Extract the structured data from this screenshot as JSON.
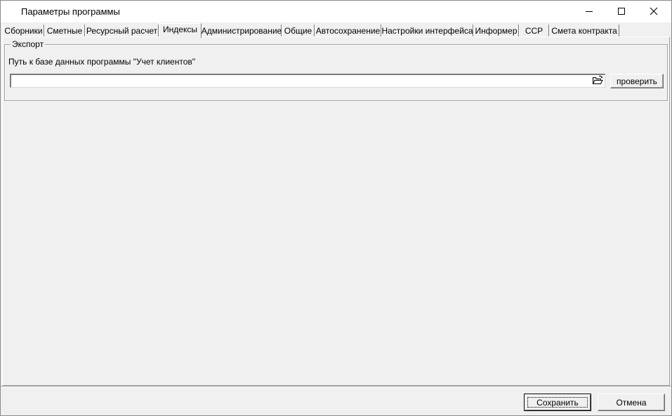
{
  "window": {
    "title": "Параметры программы",
    "icons": {
      "app": "app-icon",
      "minimize": "minimize-icon",
      "maximize": "maximize-icon",
      "close": "close-icon"
    }
  },
  "tabs": [
    {
      "label": "Сборники",
      "active": false
    },
    {
      "label": "Сметные",
      "active": false
    },
    {
      "label": "Ресурсный расчет",
      "active": false
    },
    {
      "label": "Индексы",
      "active": true
    },
    {
      "label": "Администрирование",
      "active": false
    },
    {
      "label": "Общие",
      "active": false
    },
    {
      "label": "Автосохранение",
      "active": false
    },
    {
      "label": "Настройки интерфейса",
      "active": false
    },
    {
      "label": "Информер",
      "active": false
    },
    {
      "label": "ССР",
      "active": false
    },
    {
      "label": "Смета контракта",
      "active": false
    }
  ],
  "export": {
    "group_title": "Экспорт",
    "path_label": "Путь к базе данных программы \"Учет клиентов\"",
    "path_value": "",
    "browse_icon": "folder-open-icon",
    "check_label": "проверить"
  },
  "footer": {
    "save_label": "Сохранить",
    "cancel_label": "Отмена"
  }
}
